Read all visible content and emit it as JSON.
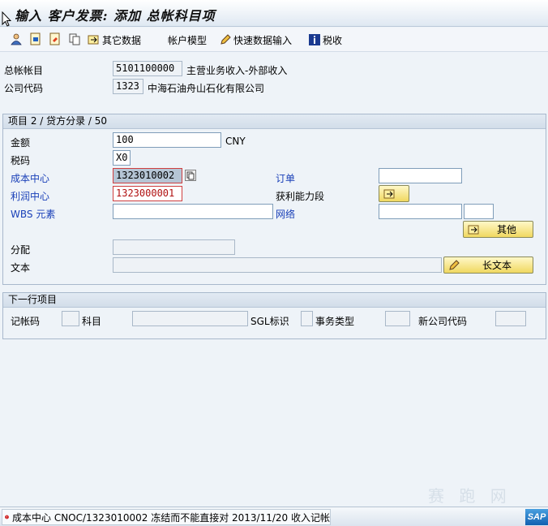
{
  "title": "输入 客户发票: 添加 总帐科目项",
  "toolbar": {
    "other_data": "其它数据",
    "account_model": "帐户模型",
    "fast_entry": "快速数据输入",
    "taxes": "税收"
  },
  "header": {
    "gl_account_label": "总帐帐目",
    "gl_account_value": "5101100000",
    "gl_account_desc": "主营业务收入-外部收入",
    "company_code_label": "公司代码",
    "company_code_value": "1323",
    "company_name": "中海石油舟山石化有限公司"
  },
  "item_group": {
    "title": "项目 2 / 贷方分录 / 50",
    "amount_label": "金额",
    "amount_value": "100",
    "currency": "CNY",
    "tax_code_label": "税码",
    "tax_code_value": "X0",
    "cost_center_label": "成本中心",
    "cost_center_value": "1323010002",
    "order_label": "订单",
    "order_value": "",
    "profit_center_label": "利润中心",
    "profit_center_value": "1323000001",
    "profitability_label": "获利能力段",
    "wbs_label": "WBS 元素",
    "wbs_value": "",
    "network_label": "网络",
    "network_value": "",
    "network_value2": "",
    "more_button": "其他",
    "assignment_label": "分配",
    "assignment_value": "",
    "text_label": "文本",
    "text_value": "",
    "long_text_button": "长文本"
  },
  "next_item": {
    "title": "下一行项目",
    "posting_key_label": "记帐码",
    "account_label": "科目",
    "sgl_label": "SGL标识",
    "transaction_type_label": "事务类型",
    "new_company_code_label": "新公司代码"
  },
  "status": {
    "message": "成本中心 CNOC/1323010002 冻结而不能直接对 2013/11/20 收入记帐",
    "type": "error",
    "error_color": "#cc1010"
  },
  "watermark": "赛 跑 网",
  "sap_logo": "SAP"
}
